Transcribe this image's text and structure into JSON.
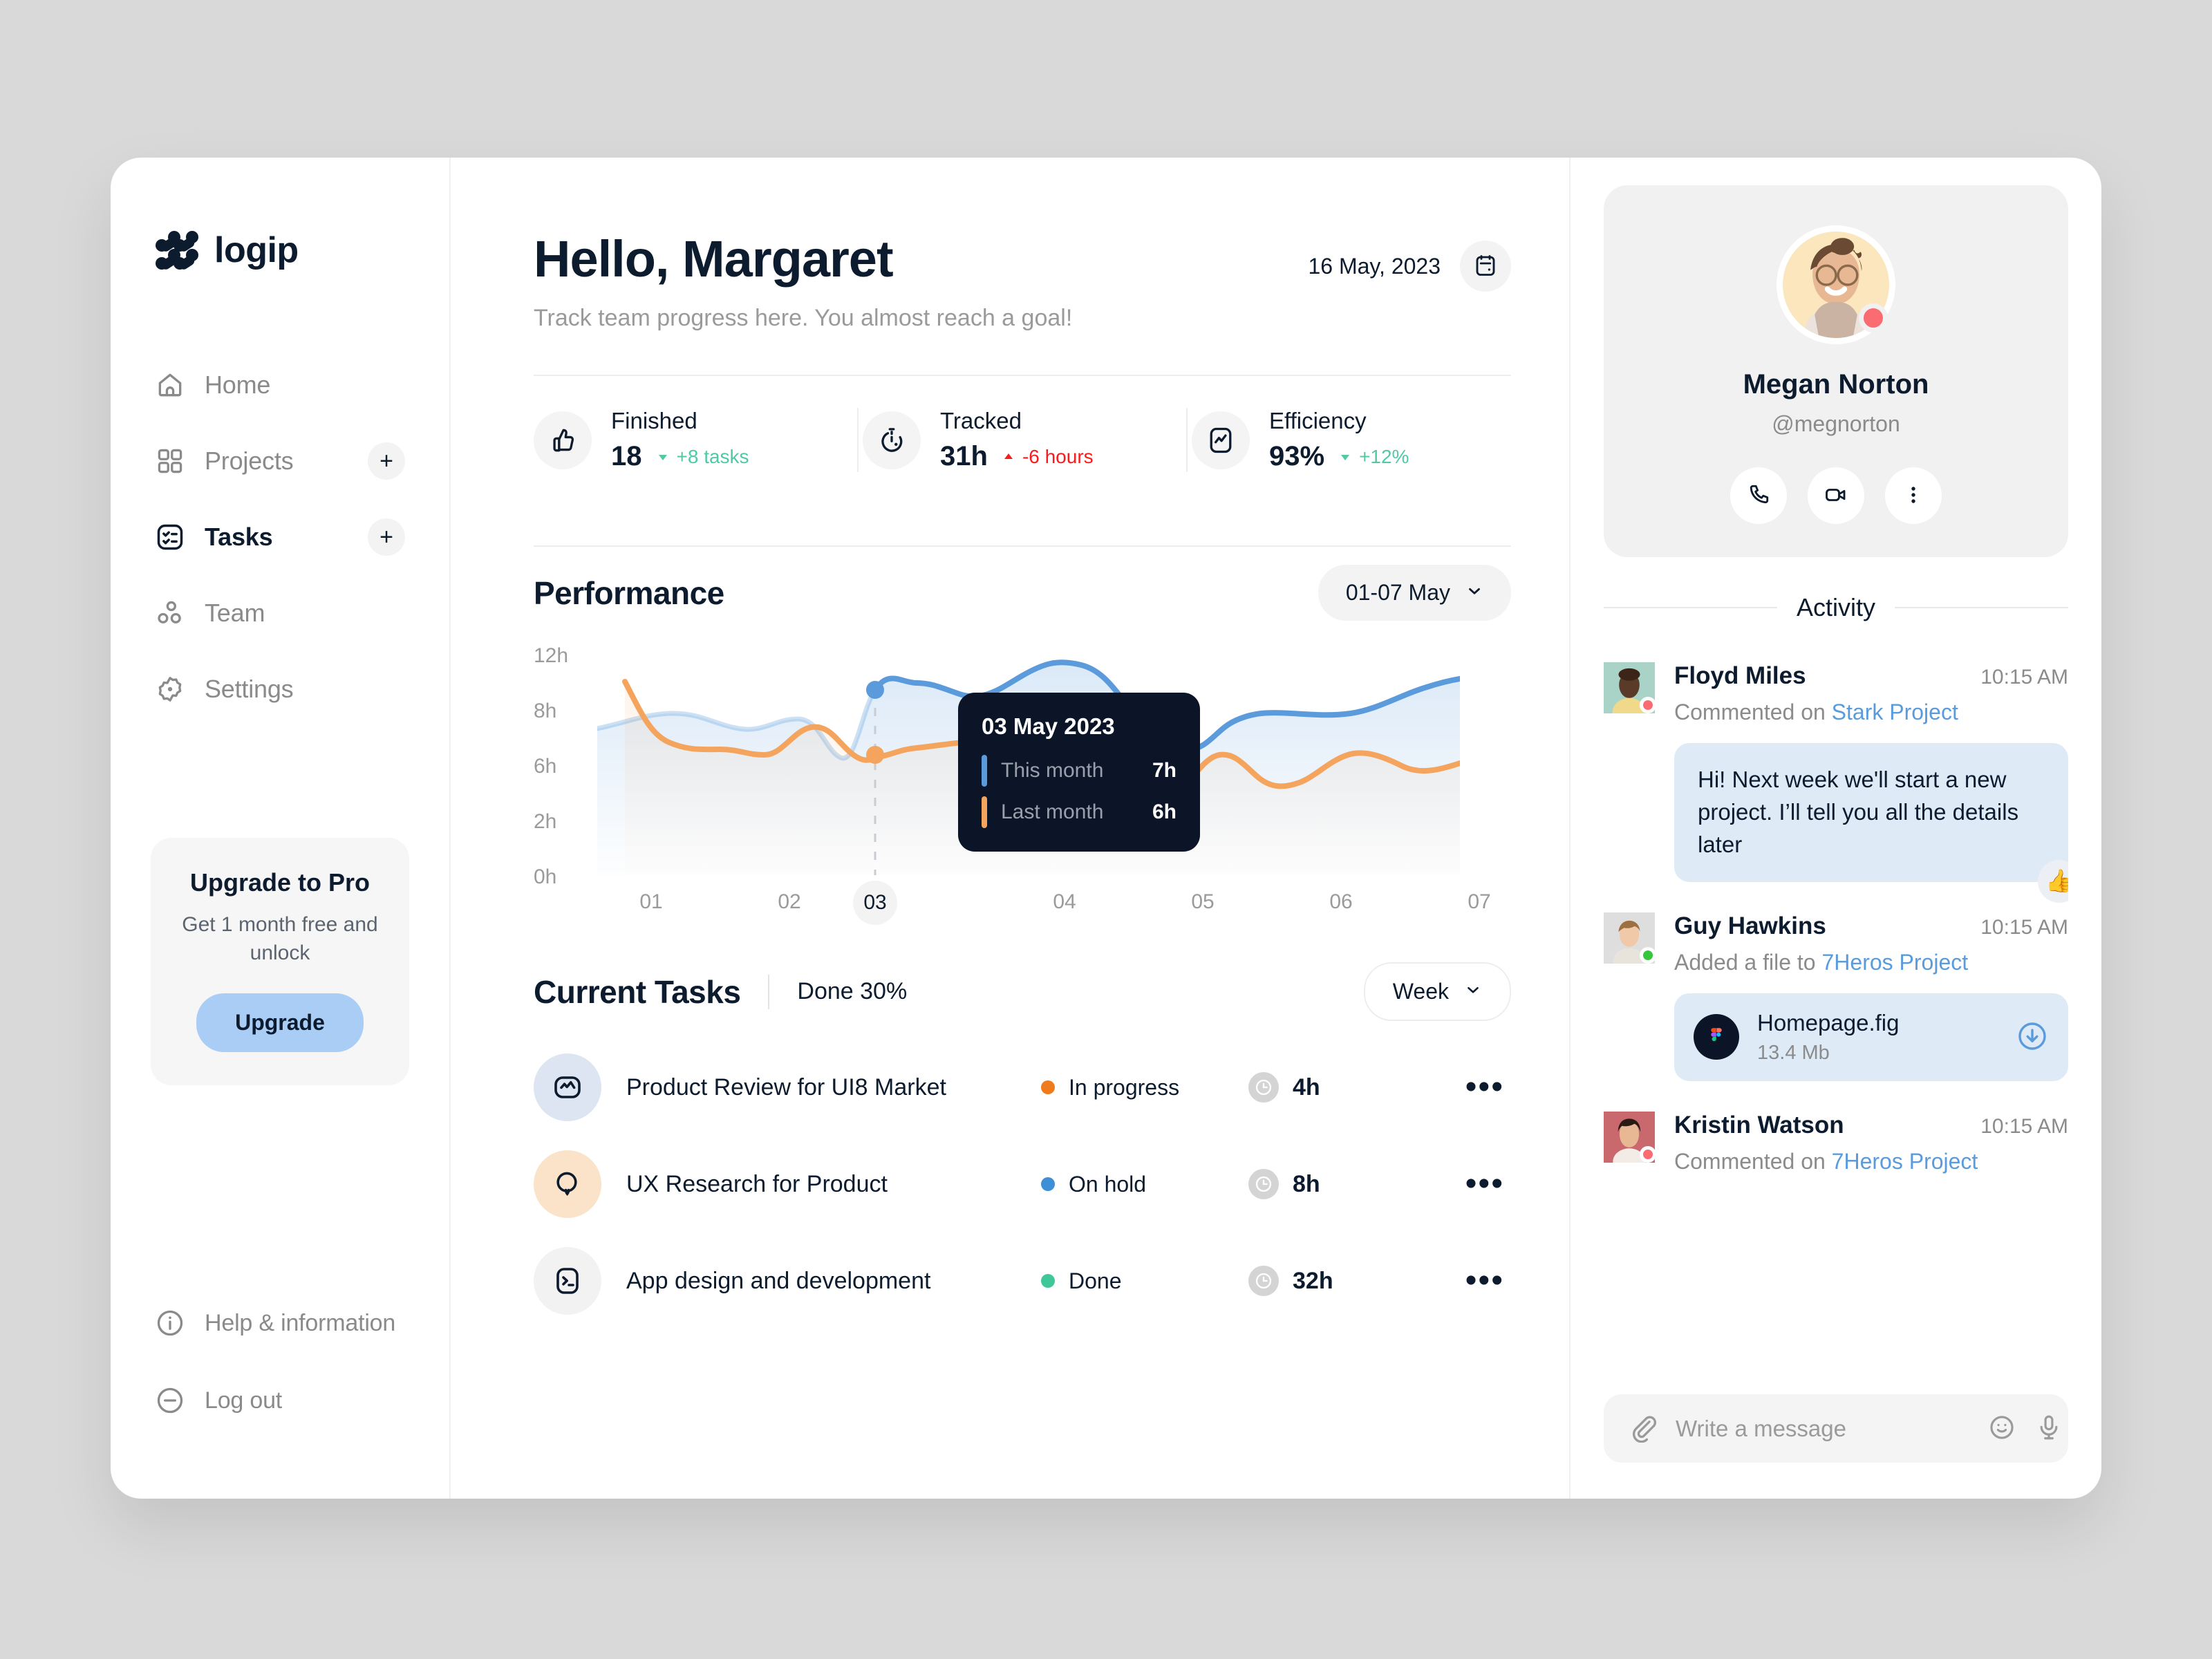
{
  "brand": {
    "name": "logip"
  },
  "sidebar": {
    "items": [
      {
        "label": "Home",
        "icon": "home-icon",
        "active": false,
        "plus": false
      },
      {
        "label": "Projects",
        "icon": "grid-icon",
        "active": false,
        "plus": true
      },
      {
        "label": "Tasks",
        "icon": "tasks-icon",
        "active": true,
        "plus": true
      },
      {
        "label": "Team",
        "icon": "team-icon",
        "active": false,
        "plus": false
      },
      {
        "label": "Settings",
        "icon": "gear-icon",
        "active": false,
        "plus": false
      }
    ],
    "upgrade": {
      "title": "Upgrade to Pro",
      "subtitle": "Get 1 month free and unlock",
      "button": "Upgrade"
    },
    "bottom": [
      {
        "label": "Help & information",
        "icon": "info-icon"
      },
      {
        "label": "Log out",
        "icon": "logout-icon"
      }
    ]
  },
  "header": {
    "greeting": "Hello, Margaret",
    "subtitle": "Track team progress here. You almost reach a goal!",
    "date": "16 May, 2023",
    "calendar_icon": "calendar-icon"
  },
  "stats": [
    {
      "name": "Finished",
      "value": "18",
      "delta": "+8 tasks",
      "direction": "up",
      "icon": "thumbs-up-icon"
    },
    {
      "name": "Tracked",
      "value": "31h",
      "delta": "-6 hours",
      "direction": "down",
      "icon": "timer-icon"
    },
    {
      "name": "Efficiency",
      "value": "93%",
      "delta": "+12%",
      "direction": "up",
      "icon": "pulse-icon"
    }
  ],
  "performance": {
    "title": "Performance",
    "range_label": "01-07 May",
    "tooltip": {
      "date": "03 May 2023",
      "rows": [
        {
          "label": "This month",
          "value": "7h",
          "color": "#5b9bdc"
        },
        {
          "label": "Last month",
          "value": "6h",
          "color": "#f5a45d"
        }
      ]
    }
  },
  "chart_data": {
    "type": "line",
    "title": "Performance",
    "xlabel": "",
    "ylabel": "hours",
    "x": [
      "01",
      "02",
      "03",
      "04",
      "05",
      "06",
      "07"
    ],
    "yticks": [
      "12h",
      "8h",
      "6h",
      "2h",
      "0h"
    ],
    "ytick_values": [
      12,
      8,
      6,
      2,
      0
    ],
    "ylim": [
      0,
      12
    ],
    "grid": false,
    "legend_position": "tooltip",
    "highlight_x": "03",
    "series": [
      {
        "name": "This month",
        "color": "#5b9bdc",
        "values": [
          6.2,
          6.4,
          7.0,
          5.4,
          8.2,
          5.8,
          7.4
        ]
      },
      {
        "name": "Last month",
        "color": "#f5a45d",
        "values": [
          8.6,
          5.6,
          6.0,
          6.6,
          5.4,
          3.4,
          5.6
        ]
      }
    ]
  },
  "tasks": {
    "title": "Current Tasks",
    "done_label": "Done 30%",
    "range_label": "Week",
    "columns": [
      "Task",
      "Status",
      "Time",
      "Menu"
    ],
    "rows": [
      {
        "name": "Product Review for UI8 Market",
        "status": "In progress",
        "status_color": "#f07b1d",
        "time": "4h",
        "icon": "pulse-square-icon",
        "icon_bg": "#dde5f2",
        "menu": "•••"
      },
      {
        "name": "UX Research for Product",
        "status": "On hold",
        "status_color": "#3e8fd6",
        "time": "8h",
        "icon": "search-icon",
        "icon_bg": "#fae3c9",
        "menu": "•••"
      },
      {
        "name": "App design and development",
        "status": "Done",
        "status_color": "#3fc79a",
        "time": "32h",
        "icon": "terminal-icon",
        "icon_bg": "#f2f2f2",
        "menu": "•••"
      }
    ]
  },
  "profile": {
    "name": "Megan Norton",
    "handle": "@megnorton",
    "status_color": "#fb6b72",
    "actions": [
      {
        "name": "call-button",
        "icon": "phone-icon"
      },
      {
        "name": "video-button",
        "icon": "video-icon"
      },
      {
        "name": "more-button",
        "icon": "more-vertical-icon"
      }
    ]
  },
  "activity": {
    "title": "Activity",
    "items": [
      {
        "name": "Floyd Miles",
        "time": "10:15 AM",
        "action_prefix": "Commented on ",
        "action_link": "Stark Project",
        "status_color": "#fb6b72",
        "avatar_bg": "#a8d3c6",
        "message": "Hi! Next week we'll start a new project. I’ll tell you all the details later",
        "reaction": "👍"
      },
      {
        "name": "Guy Hawkins",
        "time": "10:15 AM",
        "action_prefix": "Added a file to ",
        "action_link": "7Heros Project",
        "status_color": "#35c63a",
        "avatar_bg": "#dedede",
        "file": {
          "name": "Homepage.fig",
          "size": "13.4 Mb",
          "icon": "figma-icon",
          "download_icon": "download-icon"
        }
      },
      {
        "name": "Kristin Watson",
        "time": "10:15 AM",
        "action_prefix": "Commented on ",
        "action_link": "7Heros Project",
        "status_color": "#fb6b72",
        "avatar_bg": "#c9696e"
      }
    ]
  },
  "composer": {
    "placeholder": "Write a message",
    "value": "",
    "attach_icon": "paperclip-icon",
    "emoji_icon": "smiley-icon",
    "mic_icon": "microphone-icon"
  },
  "colors": {
    "accent_blue": "#5b9bdc",
    "accent_orange": "#f5a45d",
    "ink": "#0d1b2e",
    "muted": "#8b8b8b",
    "success": "#51c9a5",
    "danger": "#fb1b1b",
    "upgrade_btn": "#a9cdf4",
    "bubble": "#dfeaf7"
  }
}
